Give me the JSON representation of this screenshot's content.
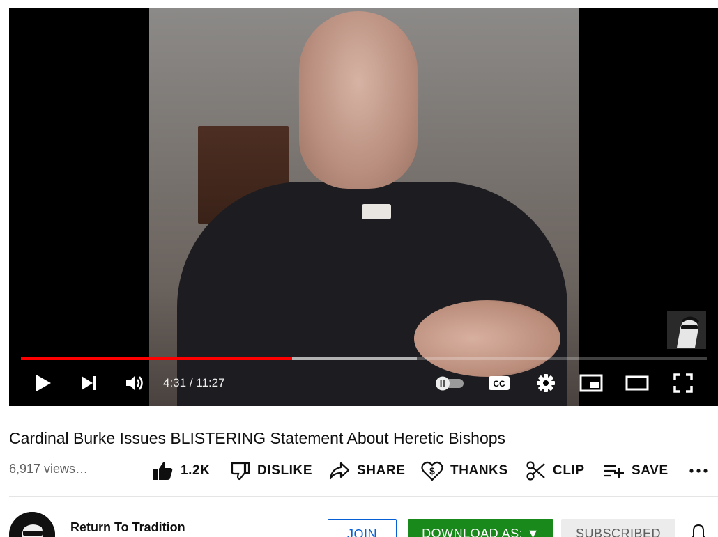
{
  "player": {
    "time_current": "4:31",
    "time_separator": "/",
    "time_total": "11:27",
    "progress_played_fraction": 0.395,
    "progress_buffered_fraction": 0.577,
    "autoplay_on": false,
    "icons": {
      "play": "play-icon",
      "next": "next-icon",
      "volume": "volume-icon",
      "autoplay": "autoplay-toggle",
      "captions": "cc-icon",
      "settings": "gear-icon",
      "miniplayer": "miniplayer-icon",
      "theater": "theater-mode-icon",
      "fullscreen": "fullscreen-icon"
    },
    "accent_color": "#ff0000"
  },
  "video": {
    "title": "Cardinal Burke Issues BLISTERING Statement About Heretic Bishops",
    "views": "6,917 views…"
  },
  "actions": {
    "like": {
      "label": "1.2K",
      "icon": "thumbs-up-icon"
    },
    "dislike": {
      "label": "DISLIKE",
      "icon": "thumbs-down-icon"
    },
    "share": {
      "label": "SHARE",
      "icon": "share-icon"
    },
    "thanks": {
      "label": "THANKS",
      "icon": "heart-dollar-icon"
    },
    "clip": {
      "label": "CLIP",
      "icon": "scissors-icon"
    },
    "save": {
      "label": "SAVE",
      "icon": "playlist-add-icon"
    },
    "more": {
      "icon": "more-icon"
    }
  },
  "channel": {
    "name": "Return To Tradition",
    "join_label": "JOIN",
    "download_label": "DOWNLOAD AS: ▼",
    "subscribed_label": "SUBSCRIBED",
    "bell_icon": "bell-icon",
    "colors": {
      "join": "#065fd4",
      "download": "#18891a",
      "subscribed_bg": "#ececec"
    }
  }
}
